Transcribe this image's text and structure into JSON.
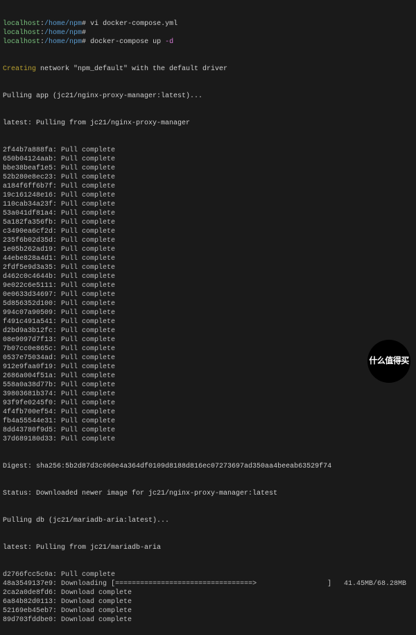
{
  "prompts": [
    {
      "host": "localhost",
      "path": "/home/npm",
      "suffix": "#",
      "cmd": "vi docker-compose.yml",
      "flag": ""
    },
    {
      "host": "localhost",
      "path": "/home/npm",
      "suffix": "#",
      "cmd": "",
      "flag": ""
    },
    {
      "host": "localhost",
      "path": "/home/npm",
      "suffix": "#",
      "cmd": "docker-compose up ",
      "flag": "-d"
    }
  ],
  "creating_line": {
    "label": "Creating",
    "rest": " network \"npm_default\" with the default driver"
  },
  "pulling_app": "Pulling app (jc21/nginx-proxy-manager:latest)...",
  "latest_pulling_app": "latest: Pulling from jc21/nginx-proxy-manager",
  "pull_complete_label": "Pull complete",
  "layers_app": [
    "2f44b7a888fa",
    "650b04124aab",
    "bbe38beaf1e5",
    "52b280e8ec23",
    "a184f6ff6b7f",
    "19c161248e16",
    "110cab34a23f",
    "53a041df81a4",
    "5a182fa356fb",
    "c3490ea6cf2d",
    "235f6b02d35d",
    "1e05b262ad19",
    "44ebe828a4d1",
    "2fdf5e9d3a35",
    "d462c0c4644b",
    "9e022c6e5111",
    "0e0633d34697",
    "5d856352d100",
    "994c07a90509",
    "f491c491a541",
    "d2bd9a3b12fc",
    "08e9097d7f13",
    "7b07cc0e865c",
    "0537e75034ad",
    "912e9faa0f19",
    "2686a004f51a",
    "558a0a38d77b",
    "39803681b374",
    "93f9fe0245f0",
    "4f4fb700ef54",
    "fb4a55544e31",
    "8dd43780f9d5",
    "37d689180d33"
  ],
  "digest": "Digest: sha256:5b2d87d3c060e4a364df0109d8188d816ec07273697ad350aa4beeab63529f74",
  "status_line": "Status: Downloaded newer image for jc21/nginx-proxy-manager:latest",
  "pulling_db": "Pulling db (jc21/mariadb-aria:latest)...",
  "latest_pulling_db": "latest: Pulling from jc21/mariadb-aria",
  "db_layers": [
    {
      "hash": "d2766fcc5c9a",
      "status": "Pull complete"
    },
    {
      "hash": "48a3549137e9",
      "status": "Downloading",
      "bar": "[=================================>                 ]",
      "size": "41.45MB/68.28MB"
    },
    {
      "hash": "2ca2a0de8fd6",
      "status": "Download complete"
    },
    {
      "hash": "6a84b82d0113",
      "status": "Download complete"
    },
    {
      "hash": "52169eb45eb7",
      "status": "Download complete"
    },
    {
      "hash": "89d703fddbe0",
      "status": "Download complete"
    }
  ],
  "watermark": "什么值得买"
}
